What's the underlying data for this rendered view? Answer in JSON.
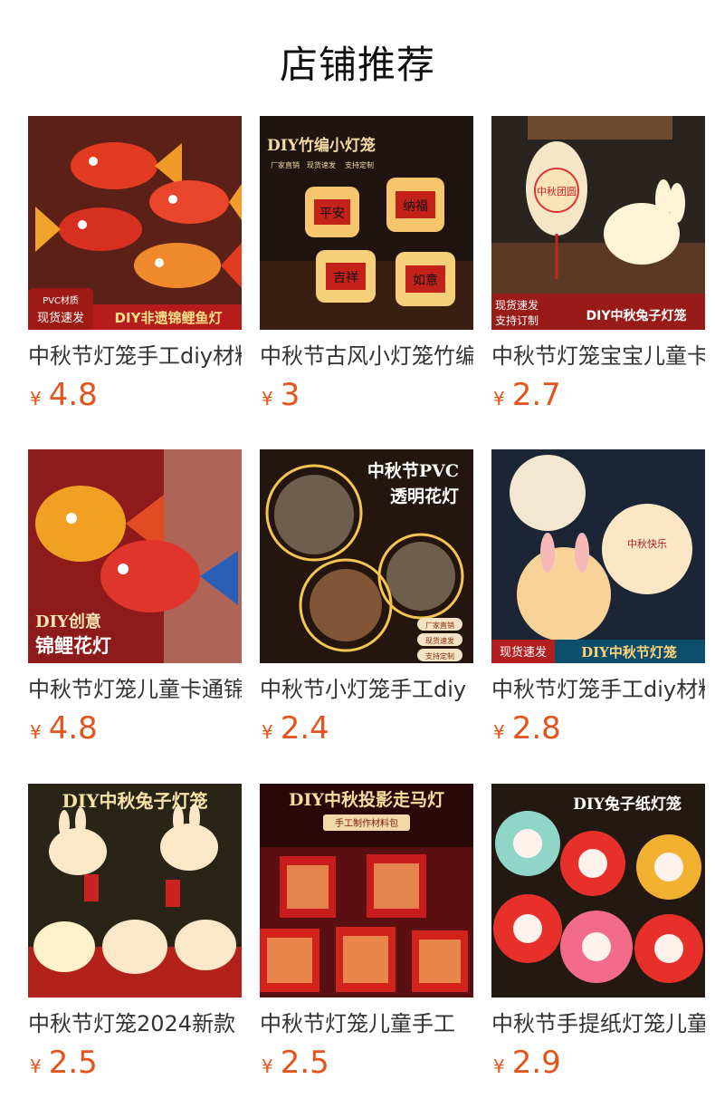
{
  "section_title": "店铺推荐",
  "currency_symbol": "¥",
  "accent_color": "#e4541d",
  "products": [
    {
      "name": "中秋节灯笼手工diy材料包",
      "price": "4.8",
      "image_text": [
        "PVC材质",
        "现货速发",
        "DIY非遗锦鲤鱼灯"
      ]
    },
    {
      "name": "中秋节古风小灯笼竹编",
      "price": "3",
      "image_text": [
        "DIY竹编小灯笼",
        "厂家直销",
        "现货速发",
        "支持定制",
        "平安",
        "纳福",
        "吉祥",
        "如意"
      ]
    },
    {
      "name": "中秋节灯笼宝宝儿童卡通",
      "price": "2.7",
      "image_text": [
        "现货速发",
        "支持订制",
        "DIY中秋兔子灯笼",
        "中秋团圆"
      ]
    },
    {
      "name": "中秋节灯笼儿童卡通锦鲤",
      "price": "4.8",
      "image_text": [
        "DIY创意",
        "锦鲤花灯"
      ]
    },
    {
      "name": "中秋节小灯笼手工diy",
      "price": "2.4",
      "image_text": [
        "中秋节PVC",
        "透明花灯",
        "厂家直销",
        "现货速发",
        "支持定制"
      ]
    },
    {
      "name": "中秋节灯笼手工diy材料",
      "price": "2.8",
      "image_text": [
        "现货速发",
        "DIY中秋节灯笼",
        "中秋快乐"
      ]
    },
    {
      "name": "中秋节灯笼2024新款",
      "price": "2.5",
      "image_text": [
        "DIY中秋兔子灯笼"
      ]
    },
    {
      "name": "中秋节灯笼儿童手工",
      "price": "2.5",
      "image_text": [
        "DIY中秋投影走马灯",
        "手工制作材料包"
      ]
    },
    {
      "name": "中秋节手提纸灯笼儿童",
      "price": "2.9",
      "image_text": [
        "DIY兔子纸灯笼"
      ]
    }
  ]
}
